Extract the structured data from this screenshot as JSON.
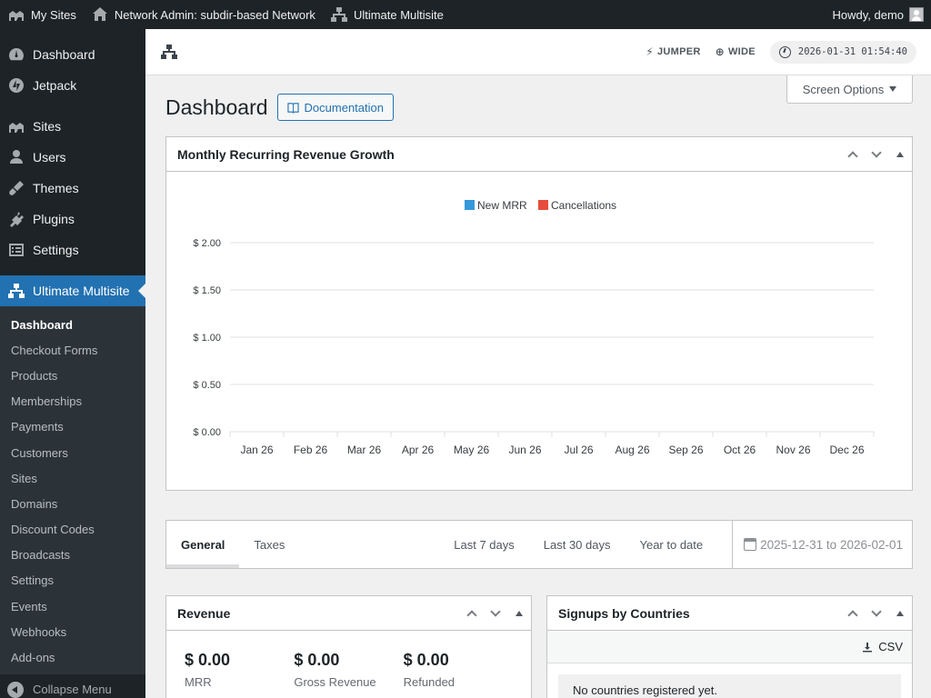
{
  "admin_bar": {
    "my_sites": "My Sites",
    "network_admin": "Network Admin: subdir-based Network",
    "plugin": "Ultimate Multisite",
    "howdy": "Howdy, demo"
  },
  "sidebar": {
    "items_top": [
      {
        "label": "Dashboard",
        "icon": "dashboard-icon"
      },
      {
        "label": "Jetpack",
        "icon": "jetpack-icon"
      }
    ],
    "items_mid": [
      {
        "label": "Sites",
        "icon": "sites-icon"
      },
      {
        "label": "Users",
        "icon": "users-icon"
      },
      {
        "label": "Themes",
        "icon": "themes-icon"
      },
      {
        "label": "Plugins",
        "icon": "plugins-icon"
      },
      {
        "label": "Settings",
        "icon": "settings-icon"
      }
    ],
    "current": {
      "label": "Ultimate Multisite",
      "icon": "network-icon"
    },
    "submenu": [
      "Dashboard",
      "Checkout Forms",
      "Products",
      "Memberships",
      "Payments",
      "Customers",
      "Sites",
      "Domains",
      "Discount Codes",
      "Broadcasts",
      "Settings",
      "Events",
      "Webhooks",
      "Add-ons"
    ],
    "collapse": "Collapse Menu"
  },
  "toolbar": {
    "jumper": "JUMPER",
    "wide": "WIDE",
    "clock": "2026-01-31 01:54:40"
  },
  "page": {
    "title": "Dashboard",
    "doc_button": "Documentation",
    "screen_options": "Screen Options"
  },
  "mrr_box": {
    "title": "Monthly Recurring Revenue Growth"
  },
  "chart_data": {
    "type": "bar",
    "title": "Monthly Recurring Revenue Growth",
    "categories": [
      "Jan 26",
      "Feb 26",
      "Mar 26",
      "Apr 26",
      "May 26",
      "Jun 26",
      "Jul 26",
      "Aug 26",
      "Sep 26",
      "Oct 26",
      "Nov 26",
      "Dec 26"
    ],
    "series": [
      {
        "name": "New MRR",
        "color": "#3498db",
        "values": [
          0,
          0,
          0,
          0,
          0,
          0,
          0,
          0,
          0,
          0,
          0,
          0
        ]
      },
      {
        "name": "Cancellations",
        "color": "#e74c3c",
        "values": [
          0,
          0,
          0,
          0,
          0,
          0,
          0,
          0,
          0,
          0,
          0,
          0
        ]
      }
    ],
    "yticks": [
      "$ 0.00",
      "$ 0.50",
      "$ 1.00",
      "$ 1.50",
      "$ 2.00"
    ],
    "ylim": [
      0,
      2
    ],
    "legend": "top-center",
    "grid": true
  },
  "tabs": {
    "items": [
      "General",
      "Taxes"
    ],
    "ranges": [
      "Last 7 days",
      "Last 30 days",
      "Year to date"
    ],
    "date_range": "2025-12-31 to 2026-02-01"
  },
  "revenue": {
    "title": "Revenue",
    "stats": [
      {
        "value": "$ 0.00",
        "label": "MRR"
      },
      {
        "value": "$ 0.00",
        "label": "Gross Revenue"
      },
      {
        "value": "$ 0.00",
        "label": "Refunded"
      }
    ]
  },
  "signups": {
    "title": "Signups by Countries",
    "csv": "CSV",
    "empty": "No countries registered yet."
  }
}
